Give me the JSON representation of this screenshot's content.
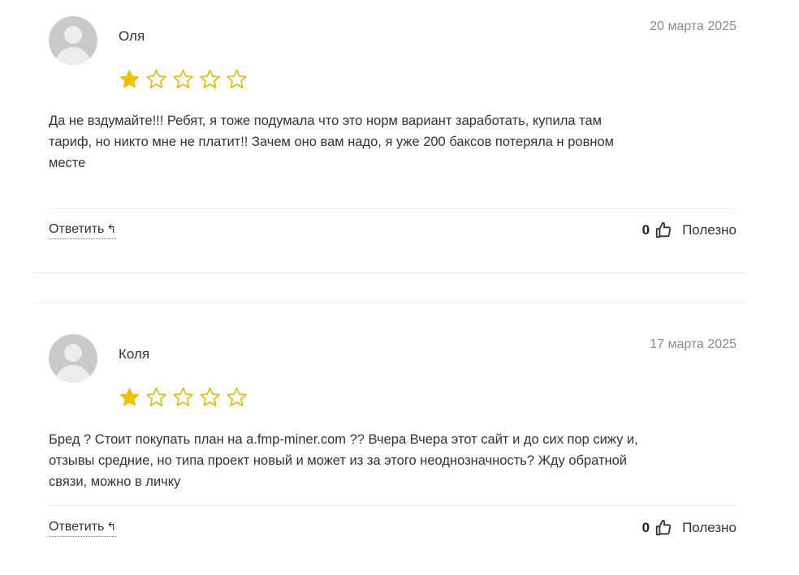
{
  "reviews": [
    {
      "author": "Оля",
      "date": "20 марта 2025",
      "rating": 1,
      "rating_max": 5,
      "text_lines": [
        "Да не вздумайте!!! Ребят, я тоже подумала что это норм вариант заработать, купила там",
        "тариф, но никто мне не платит!! Зачем оно вам надо, я уже 200 баксов потеряла н ровном",
        "месте"
      ],
      "reply_label": "Ответить",
      "reply_icon": "↰",
      "helpful_count": "0",
      "helpful_label": "Полезно"
    },
    {
      "author": "Коля",
      "date": "17 марта 2025",
      "rating": 1,
      "rating_max": 5,
      "text_lines": [
        "Бред ? Стоит покупать план на a.fmp-miner.com ?? Вчера Вчера этот сайт и до сих пор сижу и,",
        "отзывы средние, но типа проект новый и может из за этого неоднозначность? Жду обратной",
        "связи, можно в личку"
      ],
      "reply_label": "Ответить",
      "reply_icon": "↰",
      "helpful_count": "0",
      "helpful_label": "Полезно"
    }
  ],
  "colors": {
    "star": "#f2c200",
    "star_outline": "#e0b300"
  },
  "icons": {
    "avatar": "user-avatar-icon",
    "reply": "reply-arrow-icon",
    "like": "thumbs-up-icon",
    "star": "star-icon"
  }
}
